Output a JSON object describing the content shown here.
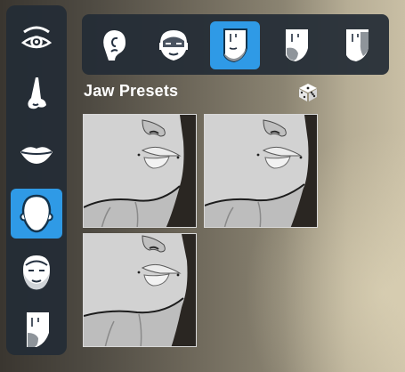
{
  "panel": {
    "section_title": "Jaw Presets"
  },
  "left_rail": {
    "items": [
      {
        "icon": "eye-icon",
        "active": false
      },
      {
        "icon": "nose-icon",
        "active": false
      },
      {
        "icon": "mouth-icon",
        "active": false
      },
      {
        "icon": "face-shape-icon",
        "active": true
      },
      {
        "icon": "head-icon",
        "active": false
      },
      {
        "icon": "skin-icon",
        "active": false
      }
    ]
  },
  "top_bar": {
    "items": [
      {
        "icon": "ear-icon",
        "active": false
      },
      {
        "icon": "head-face-icon",
        "active": false
      },
      {
        "icon": "jaw-icon",
        "active": true
      },
      {
        "icon": "cheek-icon",
        "active": false
      },
      {
        "icon": "skin-tone-icon",
        "active": false
      }
    ]
  },
  "presets": {
    "count": 3,
    "icon": "dice-icon",
    "colors": {
      "accent": "#2f9ae6",
      "panel": "#242c36",
      "thumb_skin": "#cfcfcf",
      "thumb_bg": "#2a2622"
    }
  }
}
